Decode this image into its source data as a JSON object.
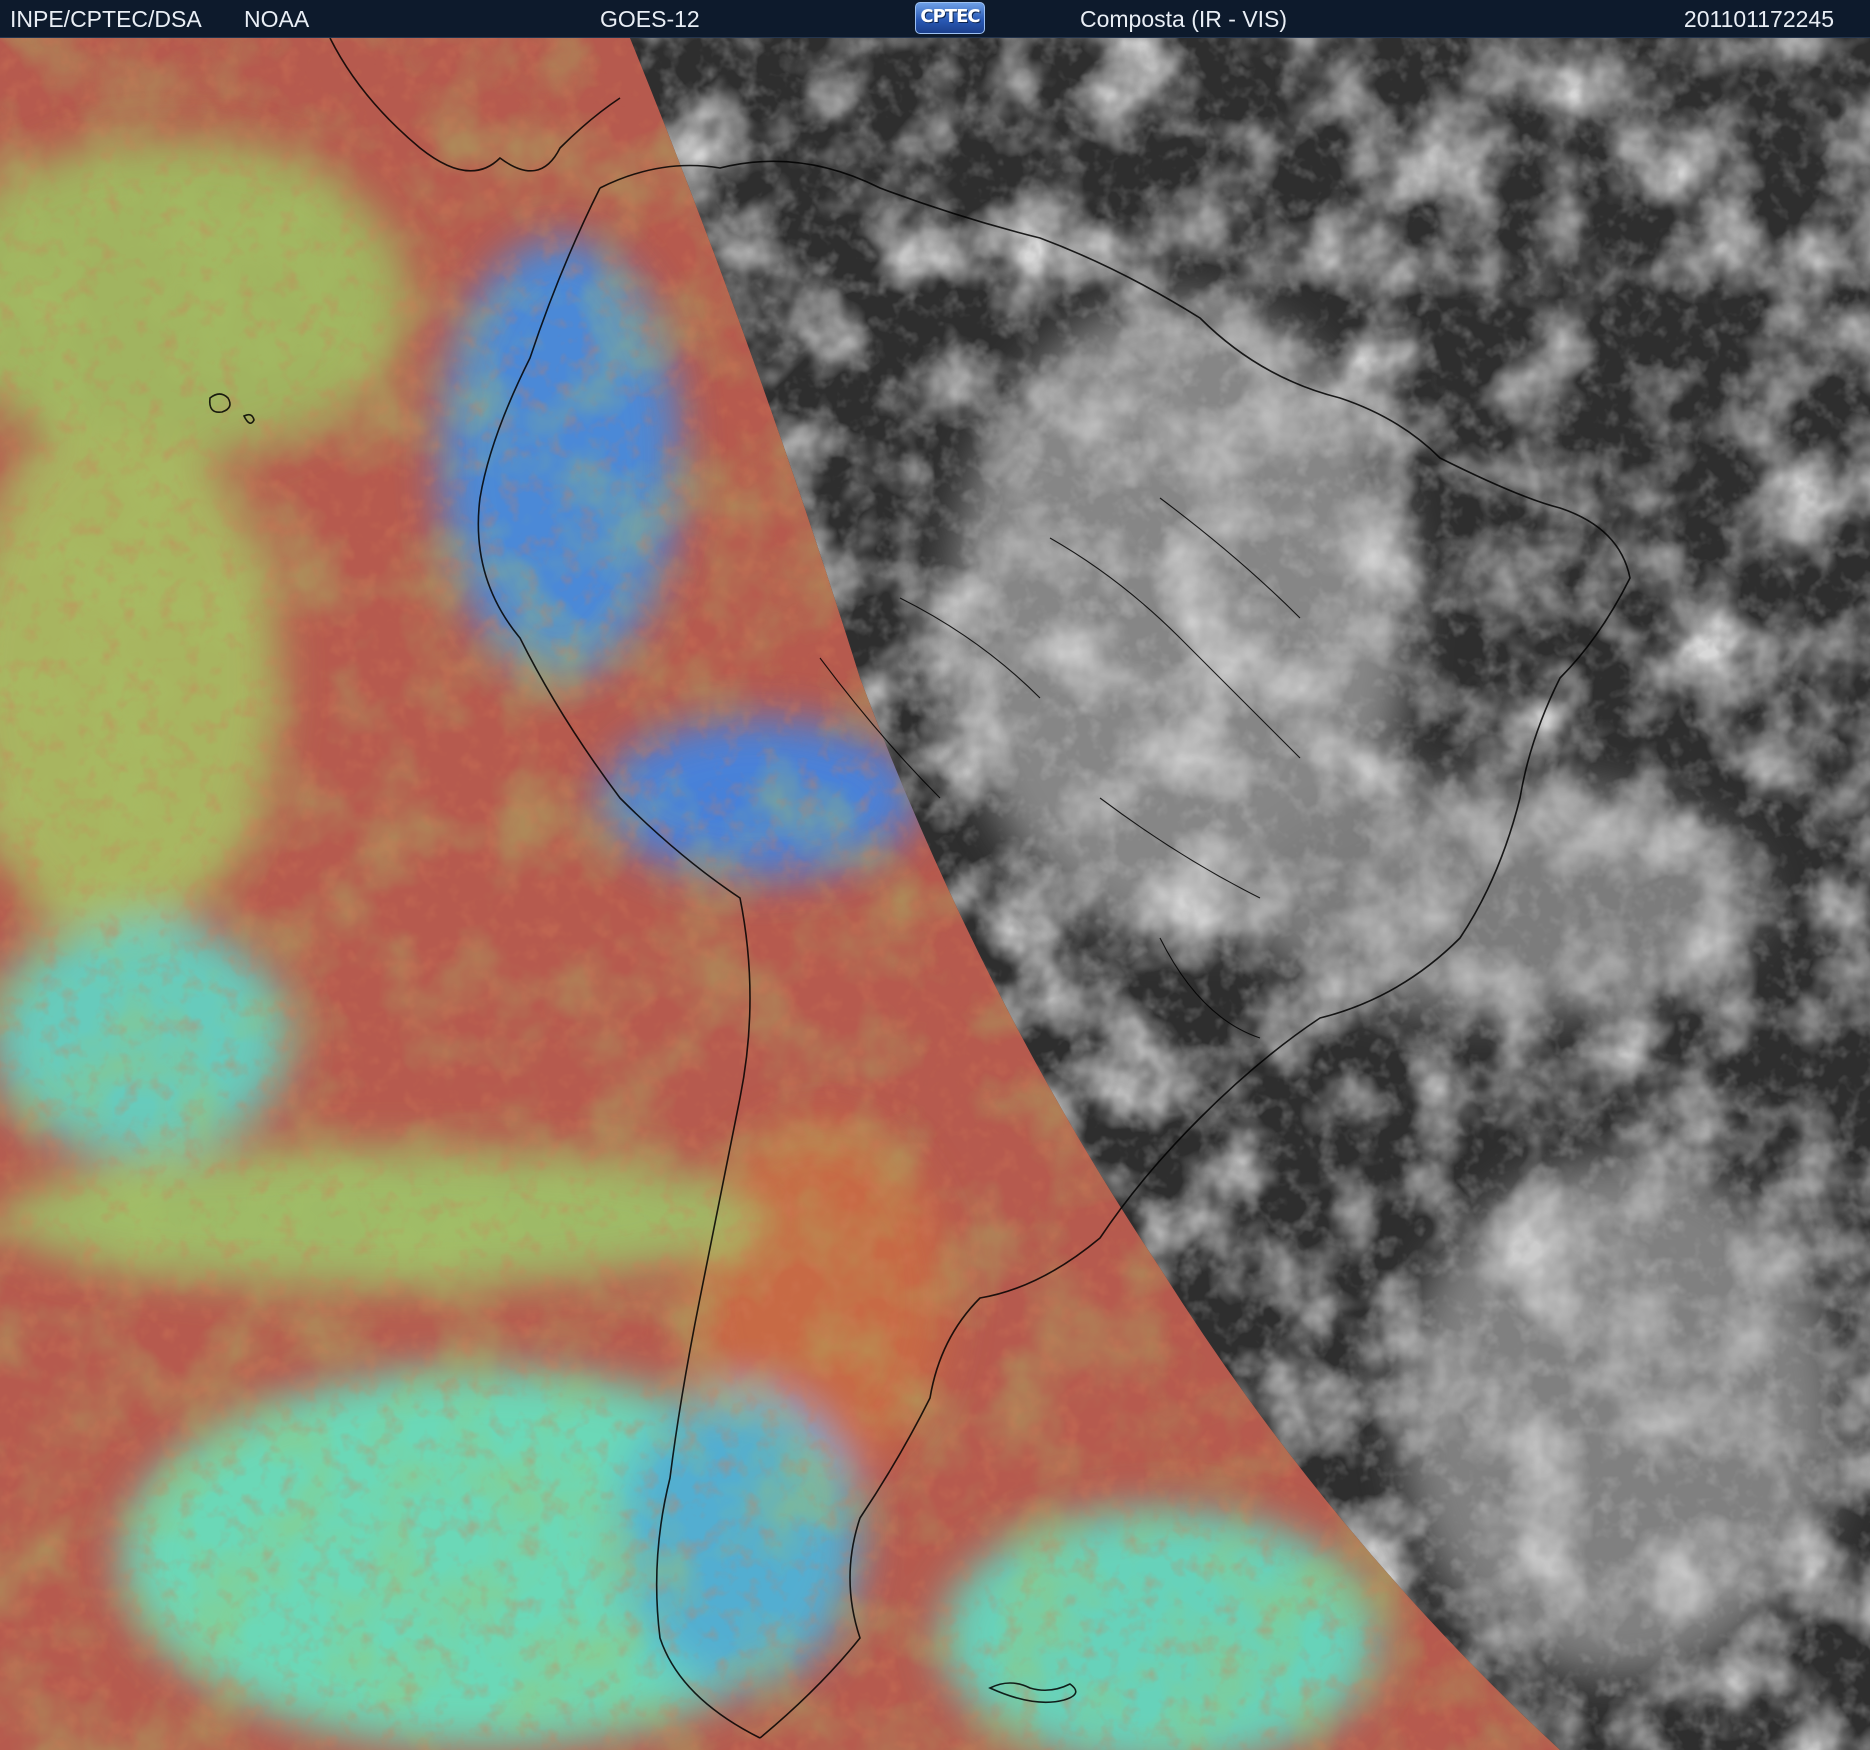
{
  "header": {
    "agency": "INPE/CPTEC/DSA",
    "source": "NOAA",
    "satellite": "GOES-12",
    "logo_text": "CPTEC",
    "product": "Composta (IR - VIS)",
    "timestamp": "201101172245"
  },
  "imagery": {
    "night_side_palette": [
      "#b7534e",
      "#c26a4a",
      "#9fbe62",
      "#5fe6c8",
      "#3e86e8"
    ],
    "day_side_palette": [
      "#2a2a2a",
      "#3d3d3d",
      "#8e8e8e",
      "#d8d8d8"
    ],
    "coastline_color": "#000000"
  }
}
